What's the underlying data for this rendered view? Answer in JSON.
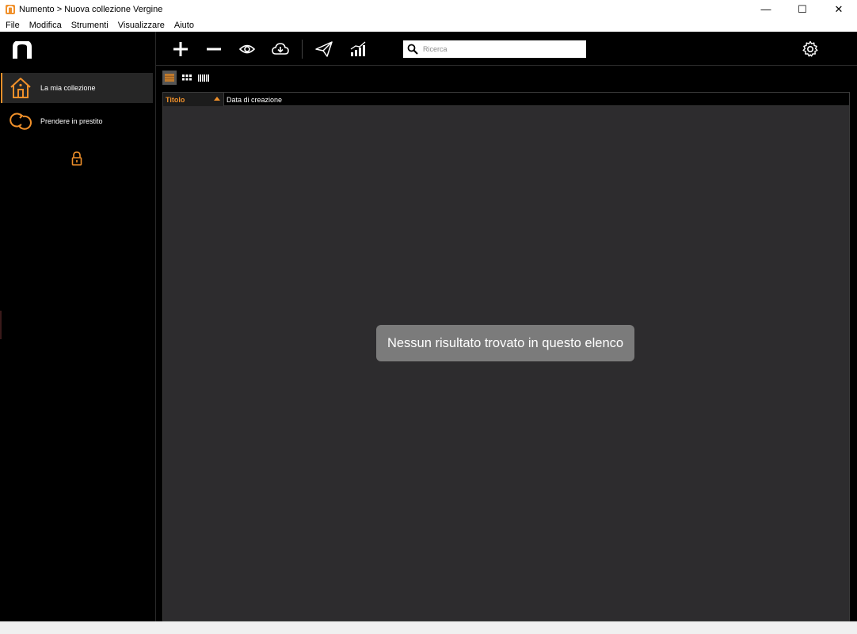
{
  "window": {
    "title": "Numento > Nuova collezione Vergine",
    "minimize": "—",
    "maximize": "☐",
    "close": "✕"
  },
  "menu": [
    "File",
    "Modifica",
    "Strumenti",
    "Visualizzare",
    "Aiuto"
  ],
  "sidebar": {
    "items": [
      {
        "label": "La mia collezione",
        "icon": "home-icon",
        "active": true
      },
      {
        "label": "Prendere in prestito",
        "icon": "lend-icon",
        "active": false
      }
    ]
  },
  "toolbar": {
    "buttons": [
      "add-icon",
      "remove-icon",
      "view-icon",
      "cloud-download-icon",
      "send-icon",
      "stats-icon",
      "settings-icon"
    ],
    "search_placeholder": "Ricerca"
  },
  "view_modes": [
    "list-view-icon",
    "grid-view-icon",
    "barcode-view-icon"
  ],
  "table": {
    "columns": [
      "Titolo",
      "Data di creazione"
    ],
    "sorted_column": "Titolo",
    "rows": []
  },
  "empty_message": "Nessun risultato trovato in questo elenco",
  "colors": {
    "accent": "#f0902a",
    "background": "#000000",
    "panel": "#2d2c2e"
  }
}
